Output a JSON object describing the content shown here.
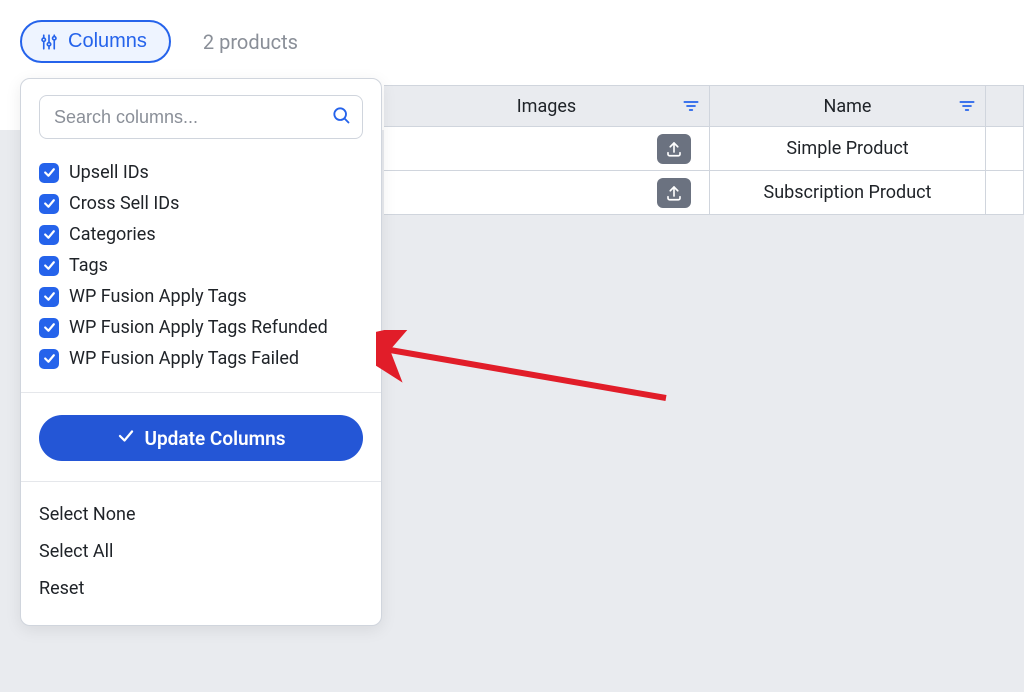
{
  "toolbar": {
    "columns_label": "Columns",
    "product_count": "2 products"
  },
  "panel": {
    "search_placeholder": "Search columns...",
    "items": [
      {
        "label": "Upsell IDs",
        "checked": true,
        "highlight": false
      },
      {
        "label": "Cross Sell IDs",
        "checked": true,
        "highlight": false
      },
      {
        "label": "Categories",
        "checked": true,
        "highlight": false
      },
      {
        "label": "Tags",
        "checked": true,
        "highlight": false
      },
      {
        "label": "WP Fusion Apply Tags",
        "checked": true,
        "highlight": true
      },
      {
        "label": "WP Fusion Apply Tags Refunded",
        "checked": true,
        "highlight": true
      },
      {
        "label": "WP Fusion Apply Tags Failed",
        "checked": true,
        "highlight": true
      }
    ],
    "update_label": "Update Columns",
    "select_none": "Select None",
    "select_all": "Select All",
    "reset": "Reset"
  },
  "table": {
    "headers": {
      "images": "Images",
      "name": "Name"
    },
    "rows": [
      {
        "name": "Simple Product"
      },
      {
        "name": "Subscription Product"
      }
    ]
  }
}
